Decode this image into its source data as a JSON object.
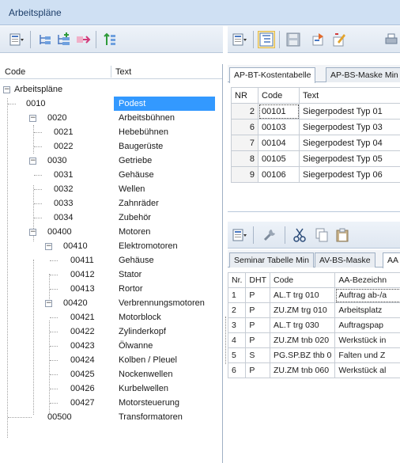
{
  "window": {
    "title": "Arbeitspläne"
  },
  "tree": {
    "header": {
      "code": "Code",
      "text": "Text"
    },
    "rows": [
      {
        "code": "Arbeitspläne",
        "text": ""
      },
      {
        "code": "0010",
        "text": "Podest",
        "selected": true
      },
      {
        "code": "0020",
        "text": "Arbeitsbühnen"
      },
      {
        "code": "0021",
        "text": "Hebebühnen"
      },
      {
        "code": "0022",
        "text": "Baugerüste"
      },
      {
        "code": "0030",
        "text": "Getriebe"
      },
      {
        "code": "0031",
        "text": "Gehäuse"
      },
      {
        "code": "0032",
        "text": "Wellen"
      },
      {
        "code": "0033",
        "text": "Zahnräder"
      },
      {
        "code": "0034",
        "text": "Zubehör"
      },
      {
        "code": "00400",
        "text": "Motoren"
      },
      {
        "code": "00410",
        "text": "Elektromotoren"
      },
      {
        "code": "00411",
        "text": "Gehäuse"
      },
      {
        "code": "00412",
        "text": "Stator"
      },
      {
        "code": "00413",
        "text": "Rortor"
      },
      {
        "code": "00420",
        "text": "Verbrennungsmotoren"
      },
      {
        "code": "00421",
        "text": "Motorblock"
      },
      {
        "code": "00422",
        "text": "Zylinderkopf"
      },
      {
        "code": "00423",
        "text": "Ölwanne"
      },
      {
        "code": "00424",
        "text": "Kolben / Pleuel"
      },
      {
        "code": "00425",
        "text": "Nockenwellen"
      },
      {
        "code": "00426",
        "text": "Kurbelwellen"
      },
      {
        "code": "00427",
        "text": "Motorsteuerung"
      },
      {
        "code": "00500",
        "text": "Transformatoren"
      }
    ]
  },
  "top_tabs": [
    "AP-BT-Kostentabelle",
    "AP-BS-Maske Min"
  ],
  "top_table": {
    "columns": [
      "NR",
      "Code",
      "Text"
    ],
    "rows": [
      [
        "2",
        "00101",
        "Siegerpodest Typ 01"
      ],
      [
        "6",
        "00103",
        "Siegerpodest Typ 03"
      ],
      [
        "7",
        "00104",
        "Siegerpodest Typ 04"
      ],
      [
        "8",
        "00105",
        "Siegerpodest Typ 05"
      ],
      [
        "9",
        "00106",
        "Siegerpodest Typ 06"
      ]
    ]
  },
  "bottom_tabs": [
    "Seminar Tabelle Min",
    "AV-BS-Maske",
    "AA"
  ],
  "bottom_table": {
    "columns": [
      "Nr.",
      "DHT",
      "Code",
      "AA-Bezeichn"
    ],
    "rows": [
      [
        "1",
        "P",
        "AL.T trg 010",
        "Auftrag ab-/a"
      ],
      [
        "2",
        "P",
        "ZU.ZM trg 010",
        "Arbeitsplatz"
      ],
      [
        "3",
        "P",
        "AL.T trg 030",
        "Auftragspap"
      ],
      [
        "4",
        "P",
        "ZU.ZM tnb 020",
        "Werkstück in"
      ],
      [
        "5",
        "S",
        "PG.SP.BZ thb 0",
        "Falten und Z"
      ],
      [
        "6",
        "P",
        "ZU.ZM tnb 060",
        "Werkstück al"
      ]
    ]
  },
  "icons": {
    "left_toolbar": [
      "view-dropdown-icon",
      "tree-insert-icon",
      "tree-add-child-icon",
      "move-right-icon",
      "sort-up-icon"
    ],
    "right_toolbar": [
      "view-dropdown-icon",
      "tree-view-icon",
      "save-icon",
      "import-icon",
      "edit-icon",
      "print-icon"
    ],
    "bottom_toolbar": [
      "view-dropdown-icon",
      "tools-icon",
      "cut-icon",
      "copy-icon",
      "paste-icon"
    ]
  },
  "colors": {
    "selection": "#3399ff",
    "titlebar": "#cfe0f3",
    "active_button": "#fde9a8"
  }
}
